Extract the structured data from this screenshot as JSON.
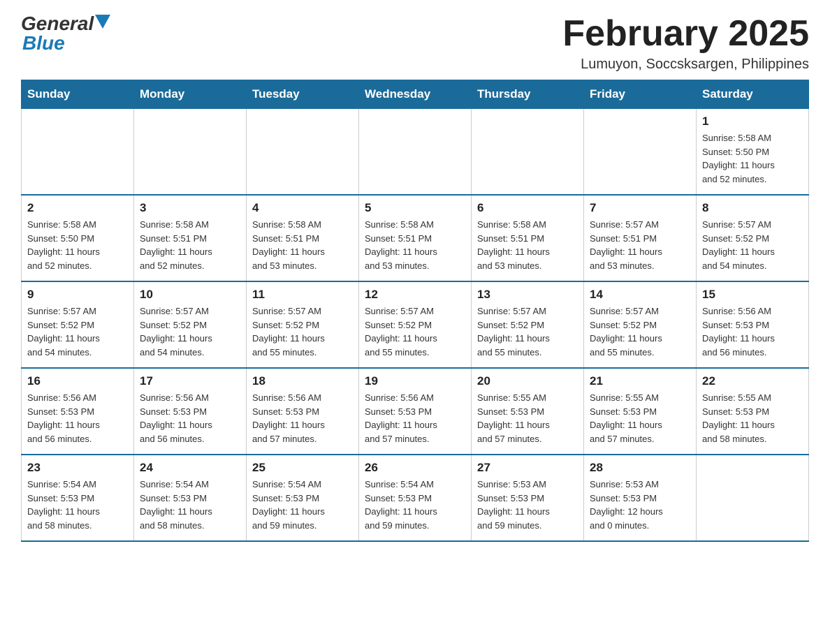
{
  "header": {
    "logo": {
      "general": "General",
      "blue": "Blue",
      "aria": "GeneralBlue logo"
    },
    "title": "February 2025",
    "subtitle": "Lumuyon, Soccsksargen, Philippines"
  },
  "calendar": {
    "days_of_week": [
      "Sunday",
      "Monday",
      "Tuesday",
      "Wednesday",
      "Thursday",
      "Friday",
      "Saturday"
    ],
    "weeks": [
      [
        {
          "day": "",
          "info": "",
          "empty": true
        },
        {
          "day": "",
          "info": "",
          "empty": true
        },
        {
          "day": "",
          "info": "",
          "empty": true
        },
        {
          "day": "",
          "info": "",
          "empty": true
        },
        {
          "day": "",
          "info": "",
          "empty": true
        },
        {
          "day": "",
          "info": "",
          "empty": true
        },
        {
          "day": "1",
          "info": "Sunrise: 5:58 AM\nSunset: 5:50 PM\nDaylight: 11 hours\nand 52 minutes.",
          "empty": false
        }
      ],
      [
        {
          "day": "2",
          "info": "Sunrise: 5:58 AM\nSunset: 5:50 PM\nDaylight: 11 hours\nand 52 minutes.",
          "empty": false
        },
        {
          "day": "3",
          "info": "Sunrise: 5:58 AM\nSunset: 5:51 PM\nDaylight: 11 hours\nand 52 minutes.",
          "empty": false
        },
        {
          "day": "4",
          "info": "Sunrise: 5:58 AM\nSunset: 5:51 PM\nDaylight: 11 hours\nand 53 minutes.",
          "empty": false
        },
        {
          "day": "5",
          "info": "Sunrise: 5:58 AM\nSunset: 5:51 PM\nDaylight: 11 hours\nand 53 minutes.",
          "empty": false
        },
        {
          "day": "6",
          "info": "Sunrise: 5:58 AM\nSunset: 5:51 PM\nDaylight: 11 hours\nand 53 minutes.",
          "empty": false
        },
        {
          "day": "7",
          "info": "Sunrise: 5:57 AM\nSunset: 5:51 PM\nDaylight: 11 hours\nand 53 minutes.",
          "empty": false
        },
        {
          "day": "8",
          "info": "Sunrise: 5:57 AM\nSunset: 5:52 PM\nDaylight: 11 hours\nand 54 minutes.",
          "empty": false
        }
      ],
      [
        {
          "day": "9",
          "info": "Sunrise: 5:57 AM\nSunset: 5:52 PM\nDaylight: 11 hours\nand 54 minutes.",
          "empty": false
        },
        {
          "day": "10",
          "info": "Sunrise: 5:57 AM\nSunset: 5:52 PM\nDaylight: 11 hours\nand 54 minutes.",
          "empty": false
        },
        {
          "day": "11",
          "info": "Sunrise: 5:57 AM\nSunset: 5:52 PM\nDaylight: 11 hours\nand 55 minutes.",
          "empty": false
        },
        {
          "day": "12",
          "info": "Sunrise: 5:57 AM\nSunset: 5:52 PM\nDaylight: 11 hours\nand 55 minutes.",
          "empty": false
        },
        {
          "day": "13",
          "info": "Sunrise: 5:57 AM\nSunset: 5:52 PM\nDaylight: 11 hours\nand 55 minutes.",
          "empty": false
        },
        {
          "day": "14",
          "info": "Sunrise: 5:57 AM\nSunset: 5:52 PM\nDaylight: 11 hours\nand 55 minutes.",
          "empty": false
        },
        {
          "day": "15",
          "info": "Sunrise: 5:56 AM\nSunset: 5:53 PM\nDaylight: 11 hours\nand 56 minutes.",
          "empty": false
        }
      ],
      [
        {
          "day": "16",
          "info": "Sunrise: 5:56 AM\nSunset: 5:53 PM\nDaylight: 11 hours\nand 56 minutes.",
          "empty": false
        },
        {
          "day": "17",
          "info": "Sunrise: 5:56 AM\nSunset: 5:53 PM\nDaylight: 11 hours\nand 56 minutes.",
          "empty": false
        },
        {
          "day": "18",
          "info": "Sunrise: 5:56 AM\nSunset: 5:53 PM\nDaylight: 11 hours\nand 57 minutes.",
          "empty": false
        },
        {
          "day": "19",
          "info": "Sunrise: 5:56 AM\nSunset: 5:53 PM\nDaylight: 11 hours\nand 57 minutes.",
          "empty": false
        },
        {
          "day": "20",
          "info": "Sunrise: 5:55 AM\nSunset: 5:53 PM\nDaylight: 11 hours\nand 57 minutes.",
          "empty": false
        },
        {
          "day": "21",
          "info": "Sunrise: 5:55 AM\nSunset: 5:53 PM\nDaylight: 11 hours\nand 57 minutes.",
          "empty": false
        },
        {
          "day": "22",
          "info": "Sunrise: 5:55 AM\nSunset: 5:53 PM\nDaylight: 11 hours\nand 58 minutes.",
          "empty": false
        }
      ],
      [
        {
          "day": "23",
          "info": "Sunrise: 5:54 AM\nSunset: 5:53 PM\nDaylight: 11 hours\nand 58 minutes.",
          "empty": false
        },
        {
          "day": "24",
          "info": "Sunrise: 5:54 AM\nSunset: 5:53 PM\nDaylight: 11 hours\nand 58 minutes.",
          "empty": false
        },
        {
          "day": "25",
          "info": "Sunrise: 5:54 AM\nSunset: 5:53 PM\nDaylight: 11 hours\nand 59 minutes.",
          "empty": false
        },
        {
          "day": "26",
          "info": "Sunrise: 5:54 AM\nSunset: 5:53 PM\nDaylight: 11 hours\nand 59 minutes.",
          "empty": false
        },
        {
          "day": "27",
          "info": "Sunrise: 5:53 AM\nSunset: 5:53 PM\nDaylight: 11 hours\nand 59 minutes.",
          "empty": false
        },
        {
          "day": "28",
          "info": "Sunrise: 5:53 AM\nSunset: 5:53 PM\nDaylight: 12 hours\nand 0 minutes.",
          "empty": false
        },
        {
          "day": "",
          "info": "",
          "empty": true
        }
      ]
    ]
  }
}
